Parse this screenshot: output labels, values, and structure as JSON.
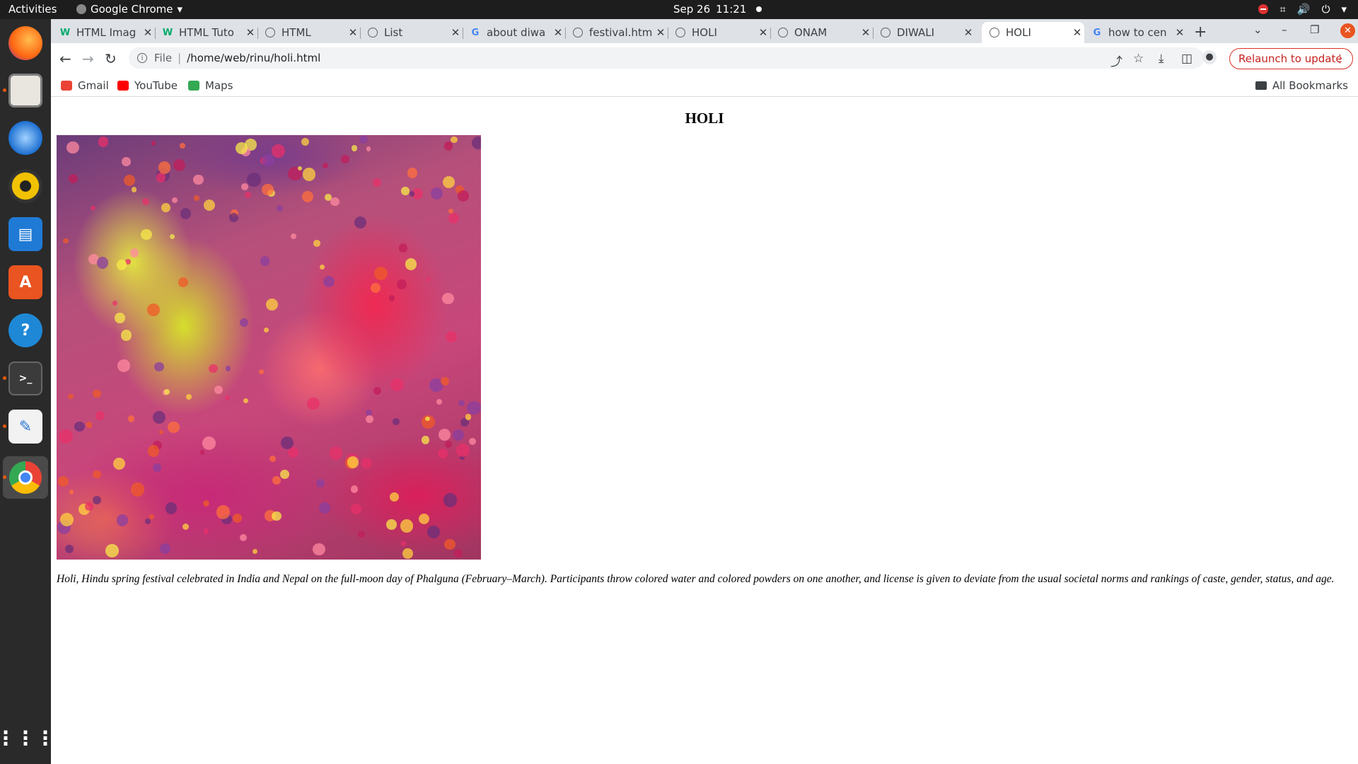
{
  "system_bar": {
    "activities": "Activities",
    "app_name": "Google Chrome",
    "date": "Sep 26",
    "time": "11:21"
  },
  "dock": {
    "items": [
      "firefox-icon",
      "files-icon",
      "thunderbird-icon",
      "rhythmbox-icon",
      "writer-icon",
      "app-center-icon",
      "help-icon",
      "terminal-icon",
      "text-editor-icon",
      "chrome-icon",
      "app-grid-icon"
    ]
  },
  "tabs": [
    {
      "label": "HTML Imag",
      "icon": "w3schools-icon"
    },
    {
      "label": "HTML Tuto",
      "icon": "w3schools-icon"
    },
    {
      "label": "HTML",
      "icon": "globe-icon"
    },
    {
      "label": "List",
      "icon": "globe-icon"
    },
    {
      "label": "about diwa",
      "icon": "google-icon"
    },
    {
      "label": "festival.htm",
      "icon": "globe-icon"
    },
    {
      "label": "HOLI",
      "icon": "globe-icon"
    },
    {
      "label": "ONAM",
      "icon": "globe-icon"
    },
    {
      "label": "DIWALI",
      "icon": "globe-icon"
    },
    {
      "label": "HOLI",
      "icon": "globe-icon",
      "active": true
    },
    {
      "label": "how to cen",
      "icon": "google-icon"
    }
  ],
  "toolbar": {
    "scheme": "File",
    "url": "/home/web/rinu/holi.html",
    "relaunch_label": "Relaunch to update"
  },
  "bookmarks": {
    "items": [
      {
        "label": "Gmail",
        "color": "#ea4335"
      },
      {
        "label": "YouTube",
        "color": "#ff0000"
      },
      {
        "label": "Maps",
        "color": "#34a853"
      }
    ],
    "all_bookmarks": "All Bookmarks"
  },
  "page": {
    "title": "HOLI",
    "caption": "Holi, Hindu spring festival celebrated in India and Nepal on the full-moon day of Phalguna (February–March). Participants throw colored water and colored powders on one another, and license is given to deviate from the usual societal norms and rankings of caste, gender, status, and age."
  }
}
